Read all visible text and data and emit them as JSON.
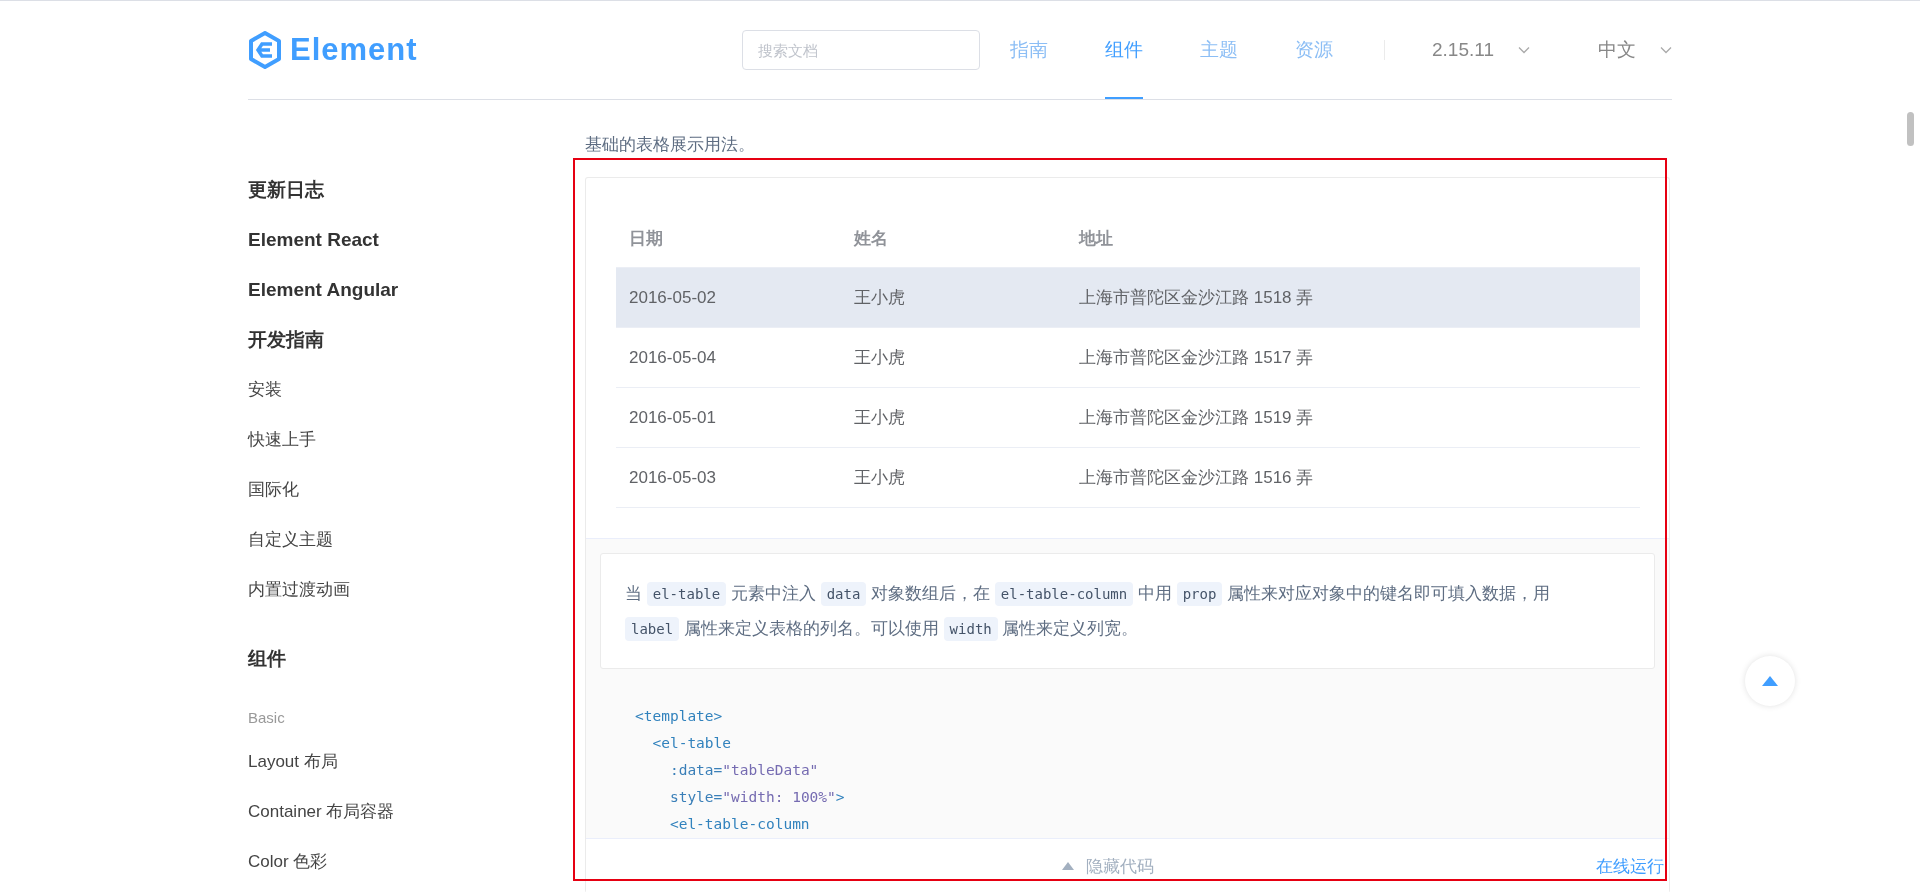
{
  "header": {
    "logo": "Element",
    "search": {
      "placeholder": "搜索文档"
    },
    "nav": [
      {
        "label": "指南",
        "selected": false
      },
      {
        "label": "组件",
        "selected": true
      },
      {
        "label": "主题",
        "selected": false
      },
      {
        "label": "资源",
        "selected": false
      }
    ],
    "version": "2.15.11",
    "language": "中文"
  },
  "sidebar": {
    "items": [
      {
        "kind": "heading",
        "label": "更新日志"
      },
      {
        "kind": "heading",
        "label": "Element React"
      },
      {
        "kind": "heading",
        "label": "Element Angular"
      },
      {
        "kind": "title",
        "label": "开发指南"
      },
      {
        "kind": "link",
        "label": "安装"
      },
      {
        "kind": "link",
        "label": "快速上手"
      },
      {
        "kind": "link",
        "label": "国际化"
      },
      {
        "kind": "link",
        "label": "自定义主题"
      },
      {
        "kind": "link",
        "label": "内置过渡动画"
      },
      {
        "kind": "title",
        "label": "组件"
      },
      {
        "kind": "group",
        "label": "Basic"
      },
      {
        "kind": "link",
        "label": "Layout 布局"
      },
      {
        "kind": "link",
        "label": "Container 布局容器"
      },
      {
        "kind": "link",
        "label": "Color 色彩"
      }
    ]
  },
  "main": {
    "intro": "基础的表格展示用法。",
    "demo": {
      "table": {
        "columns": [
          "日期",
          "姓名",
          "地址"
        ],
        "rows": [
          {
            "cells": [
              "2016-05-02",
              "王小虎",
              "上海市普陀区金沙江路 1518 弄"
            ],
            "highlighted": true
          },
          {
            "cells": [
              "2016-05-04",
              "王小虎",
              "上海市普陀区金沙江路 1517 弄"
            ],
            "highlighted": false
          },
          {
            "cells": [
              "2016-05-01",
              "王小虎",
              "上海市普陀区金沙江路 1519 弄"
            ],
            "highlighted": false
          },
          {
            "cells": [
              "2016-05-03",
              "王小虎",
              "上海市普陀区金沙江路 1516 弄"
            ],
            "highlighted": false
          }
        ]
      },
      "description": {
        "lines": [
          [
            {
              "kind": "text",
              "text": "当 "
            },
            {
              "kind": "code",
              "text": "el-table"
            },
            {
              "kind": "text",
              "text": " 元素中注入 "
            },
            {
              "kind": "code",
              "text": "data"
            },
            {
              "kind": "text",
              "text": " 对象数组后，在 "
            },
            {
              "kind": "code",
              "text": "el-table-column"
            },
            {
              "kind": "text",
              "text": " 中用 "
            },
            {
              "kind": "code",
              "text": "prop"
            },
            {
              "kind": "text",
              "text": " 属性来对应对象中的键名即可填入数据，用"
            }
          ],
          [
            {
              "kind": "code",
              "text": "label"
            },
            {
              "kind": "text",
              "text": " 属性来定义表格的列名。可以使用 "
            },
            {
              "kind": "code",
              "text": "width"
            },
            {
              "kind": "text",
              "text": " 属性来定义列宽。"
            }
          ]
        ]
      },
      "code": [
        [
          {
            "kind": "tag",
            "text": "<template>"
          }
        ],
        [
          {
            "kind": "tag",
            "text": "  <el-table"
          }
        ],
        [
          {
            "kind": "attr",
            "text": "    :data="
          },
          {
            "kind": "string",
            "text": "\"tableData\""
          }
        ],
        [
          {
            "kind": "attr",
            "text": "    style="
          },
          {
            "kind": "string",
            "text": "\"width: 100%\""
          },
          {
            "kind": "tag",
            "text": ">"
          }
        ],
        [
          {
            "kind": "tag",
            "text": "    <el-table-column"
          }
        ]
      ],
      "footer": {
        "toggle": "隐藏代码",
        "run": "在线运行"
      }
    }
  }
}
